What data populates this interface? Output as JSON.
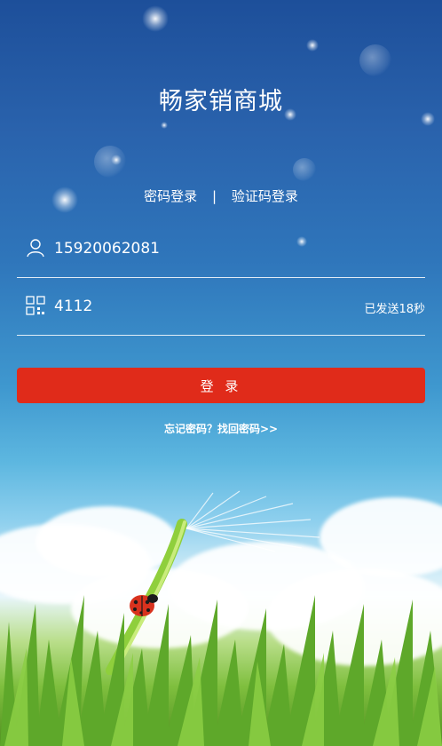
{
  "app": {
    "title": "畅家销商城"
  },
  "login_modes": {
    "password": "密码登录",
    "separator": "|",
    "sms": "验证码登录"
  },
  "phone": {
    "value": "15920062081",
    "icon": "user-icon"
  },
  "code": {
    "value": "4112",
    "icon": "qrcode-icon",
    "status": "已发送18秒"
  },
  "actions": {
    "login_label": "登 录",
    "forgot_label": "忘记密码？找回密码>>"
  },
  "colors": {
    "accent": "#e02b1a",
    "text": "#ffffff"
  }
}
